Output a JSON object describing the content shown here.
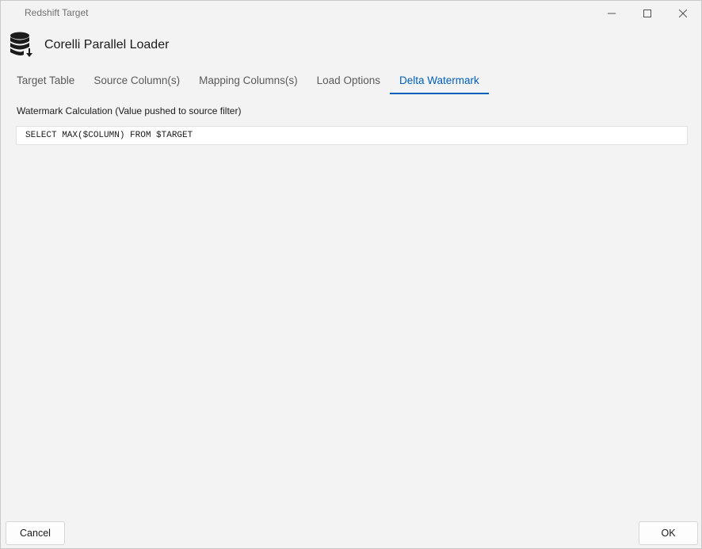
{
  "window": {
    "title": "Redshift Target"
  },
  "header": {
    "app_icon": "database-download-icon",
    "title": "Corelli Parallel Loader"
  },
  "tabs": [
    {
      "label": "Target Table",
      "active": false
    },
    {
      "label": "Source Column(s)",
      "active": false
    },
    {
      "label": "Mapping Columns(s)",
      "active": false
    },
    {
      "label": "Load Options",
      "active": false
    },
    {
      "label": "Delta Watermark",
      "active": true
    }
  ],
  "watermark": {
    "label": "Watermark Calculation (Value pushed to source filter)",
    "value": "SELECT MAX($COLUMN) FROM $TARGET"
  },
  "footer": {
    "cancel_label": "Cancel",
    "ok_label": "OK"
  },
  "colors": {
    "accent": "#005fb8",
    "background": "#f3f3f3"
  }
}
